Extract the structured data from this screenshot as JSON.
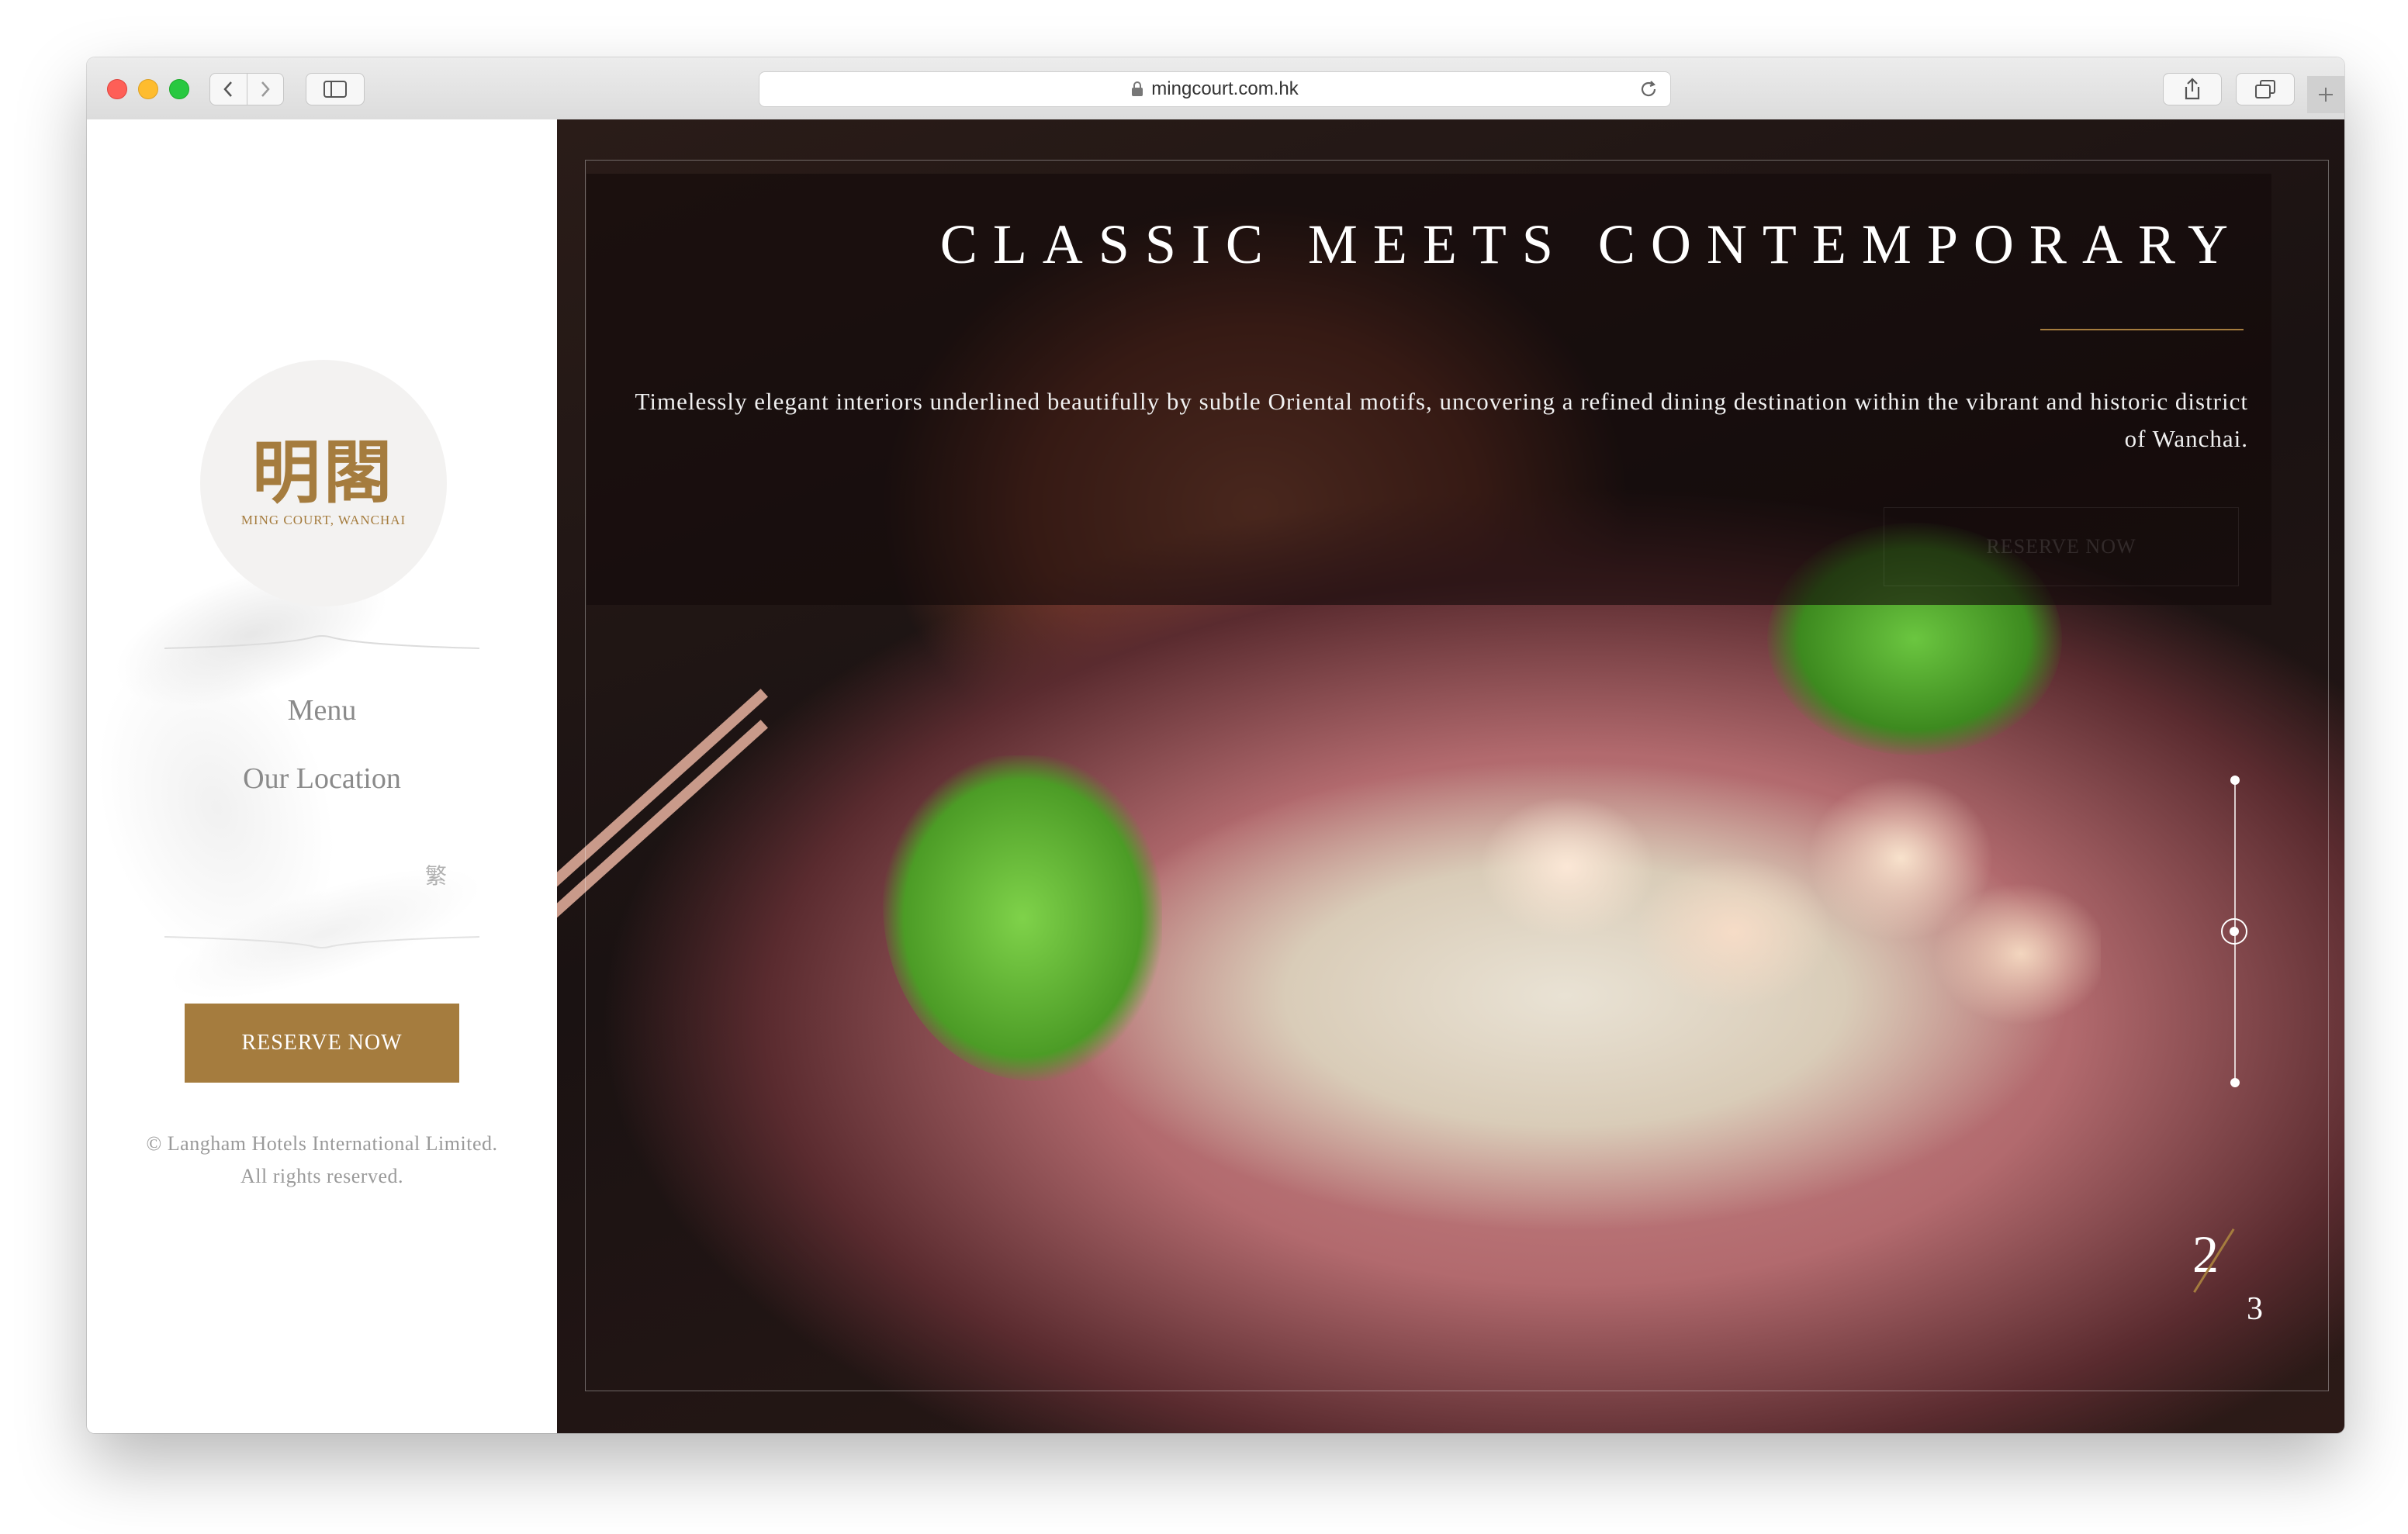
{
  "browser": {
    "url": "mingcourt.com.hk"
  },
  "sidebar": {
    "logo_cn": "明閣",
    "logo_en": "MING COURT, WANCHAI",
    "nav": [
      {
        "label": "Menu"
      },
      {
        "label": "Our Location"
      }
    ],
    "language_toggle": "繁",
    "reserve_label": "RESERVE NOW",
    "copyright_line1": "© Langham Hotels International Limited.",
    "copyright_line2": "All rights reserved."
  },
  "hero": {
    "title": "CLASSIC MEETS CONTEMPORARY",
    "description": "Timelessly elegant interiors underlined beautifully by subtle Oriental motifs, uncovering a refined dining destination within the vibrant and historic district of Wanchai.",
    "ghost_button": "RESERVE NOW",
    "slide_current": "2",
    "slide_total": "3"
  },
  "colors": {
    "brand_gold": "#a57c3e"
  },
  "icons": {
    "back": "chevron-left-icon",
    "forward": "chevron-right-icon",
    "sidebar": "sidebar-icon",
    "lock": "lock-icon",
    "reload": "reload-icon",
    "share": "share-icon",
    "tabs": "tabs-icon",
    "new_tab": "plus-icon"
  }
}
